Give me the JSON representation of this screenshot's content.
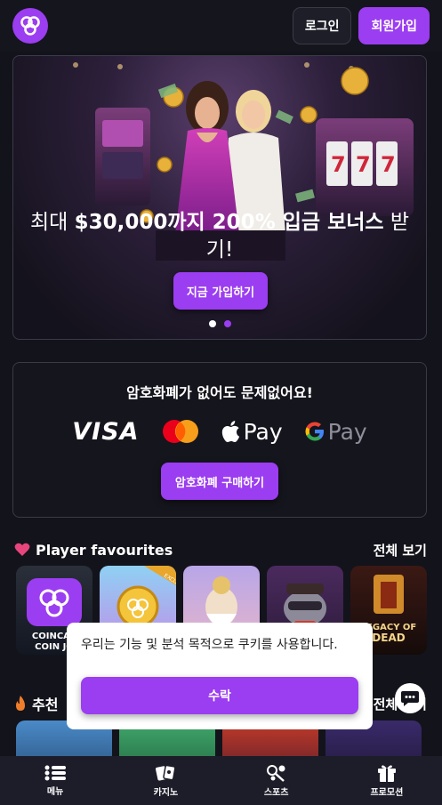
{
  "header": {
    "login_label": "로그인",
    "signup_label": "회원가입"
  },
  "hero": {
    "title_prefix": "최대 ",
    "title_bold": "$30,000까지 200% 입금 보너스",
    "title_suffix": " 받기!",
    "cta_label": "지금 가입하기",
    "slides": 2,
    "active_slide": 2
  },
  "payment": {
    "title": "암호화폐가 없어도 문제없어요!",
    "methods": {
      "visa": "VISA",
      "apple_pay": "Pay",
      "google_pay": "Pay"
    },
    "cta_label": "암호화폐 구매하기"
  },
  "favourites": {
    "title": "Player favourites",
    "see_all": "전체 보기",
    "tiles": [
      {
        "name": "coincasino-coin-jo",
        "label": "COINCAS COIN JO"
      },
      {
        "name": "exclusive-tile",
        "label": "EXCLUSIVE"
      },
      {
        "name": "zeus-tile",
        "label": ""
      },
      {
        "name": "raccoon-tile",
        "label": ""
      },
      {
        "name": "legacy-of-dead",
        "label": "LEGACY OF DEAD"
      }
    ]
  },
  "recommended": {
    "title": "추천",
    "see_all": "전체 보기"
  },
  "cookie": {
    "text": "우리는 기능 및 분석 목적으로 쿠키를 사용합니다.",
    "accept_label": "수락"
  },
  "bottom_nav": [
    {
      "label": "메뉴",
      "icon": "menu-icon"
    },
    {
      "label": "카지노",
      "icon": "cards-icon"
    },
    {
      "label": "스포츠",
      "icon": "sports-icon"
    },
    {
      "label": "프로모션",
      "icon": "gift-icon"
    }
  ],
  "colors": {
    "accent": "#9b3df0",
    "background": "#13131b",
    "card": "#15151d"
  }
}
